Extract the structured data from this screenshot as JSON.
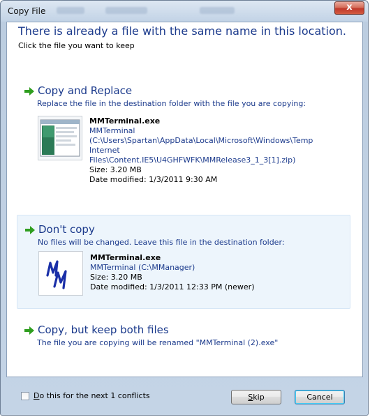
{
  "window": {
    "title": "Copy File",
    "close_glyph": "x"
  },
  "header": {
    "headline": "There is already a file with the same name in this location.",
    "subline": "Click the file you want to keep"
  },
  "options": {
    "copy_replace": {
      "title": "Copy and Replace",
      "description": "Replace the file in the destination folder with the file you are copying:",
      "file": {
        "name": "MMTerminal.exe",
        "path_line1": "MMTerminal",
        "path_line2": "(C:\\Users\\Spartan\\AppData\\Local\\Microsoft\\Windows\\Temp",
        "path_line3": "Internet",
        "path_line4": "Files\\Content.IE5\\U4GHFWFK\\MMRelease3_1_3[1].zip)",
        "size": "Size: 3.20 MB",
        "modified": "Date modified: 1/3/2011 9:30 AM"
      }
    },
    "dont_copy": {
      "title": "Don't copy",
      "description": "No files will be changed. Leave this file in the destination folder:",
      "file": {
        "name": "MMTerminal.exe",
        "path": "MMTerminal (C:\\MManager)",
        "size": "Size: 3.20 MB",
        "modified": "Date modified: 1/3/2011 12:33 PM (newer)"
      }
    },
    "copy_keep_both": {
      "title": "Copy, but keep both files",
      "description": "The file you are copying will be renamed \"MMTerminal (2).exe\""
    }
  },
  "footer": {
    "checkbox_label_first": "D",
    "checkbox_label_rest": "o this for the next 1 conflicts",
    "checkbox_checked": false,
    "skip_first": "S",
    "skip_rest": "kip",
    "cancel_label": "Cancel"
  },
  "colors": {
    "link_blue": "#1b3a8c",
    "arrow_green": "#2f9e1f",
    "selected_bg": "#edf5fc"
  }
}
